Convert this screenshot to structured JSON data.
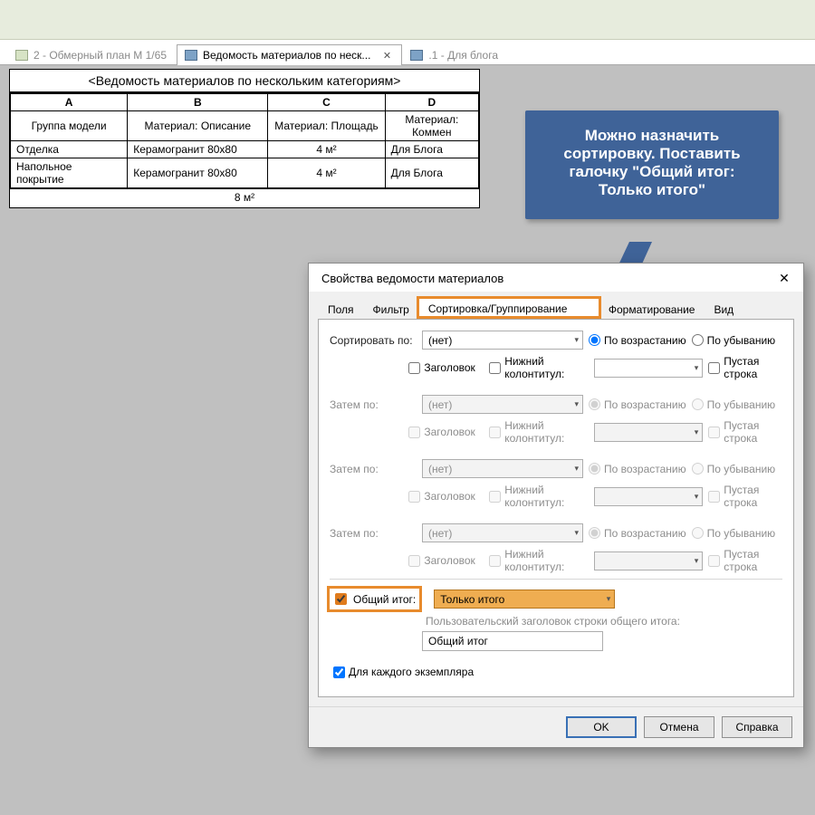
{
  "tabs": {
    "t1": "2 - Обмерный план М 1/65",
    "t2": "Ведомость материалов по неск...",
    "t3": ".1 - Для блога"
  },
  "schedule": {
    "title": "<Ведомость материалов по нескольким категориям>",
    "cols": {
      "a": "A",
      "b": "B",
      "c": "C",
      "d": "D"
    },
    "headers": {
      "a": "Группа модели",
      "b": "Материал: Описание",
      "c": "Материал: Площадь",
      "d": "Материал: Коммен"
    },
    "rows": [
      {
        "a": "Отделка",
        "b": "Керамогранит 80х80",
        "c": "4 м²",
        "d": "Для Блога"
      },
      {
        "a": "Напольное покрытие",
        "b": "Керамогранит 80х80",
        "c": "4 м²",
        "d": "Для Блога"
      }
    ],
    "total": "8 м²"
  },
  "callout": "Можно назначить сортировку. Поставить галочку \"Общий итог: Только итого\"",
  "dlg": {
    "title": "Свойства ведомости материалов",
    "tabs": {
      "fields": "Поля",
      "filter": "Фильтр",
      "sort": "Сортировка/Группирование",
      "fmt": "Форматирование",
      "view": "Вид"
    },
    "sort_by": "Сортировать по:",
    "then_by": "Затем по:",
    "none": "(нет)",
    "asc": "По возрастанию",
    "desc": "По убыванию",
    "header": "Заголовок",
    "footer": "Нижний колонтитул:",
    "blank": "Пустая строка",
    "grand": "Общий итог:",
    "grand_opt": "Только итого",
    "custom_label": "Пользовательский заголовок строки общего итога:",
    "grand_text": "Общий итог",
    "each": "Для каждого экземпляра",
    "ok": "OK",
    "cancel": "Отмена",
    "help": "Справка"
  }
}
